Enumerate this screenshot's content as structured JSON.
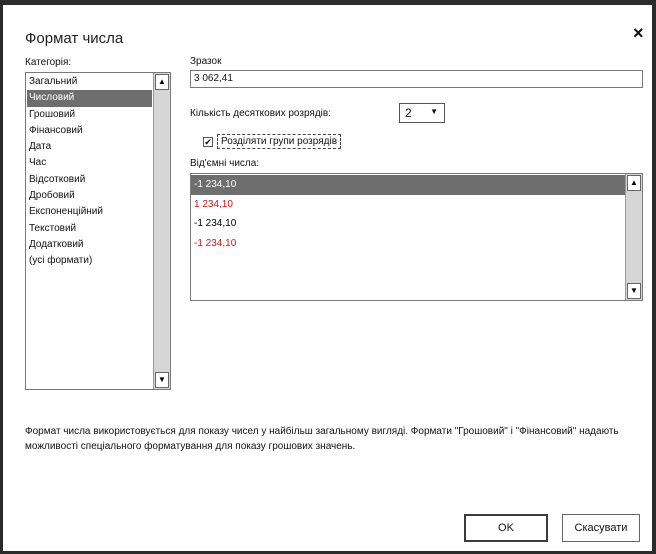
{
  "dialog": {
    "title": "Формат числа",
    "close_glyph": "×"
  },
  "category": {
    "label": "Категорія:",
    "items": [
      {
        "label": "Загальний"
      },
      {
        "label": "Числовий",
        "selected": true
      },
      {
        "label": "Грошовий"
      },
      {
        "label": "Фінансовий"
      },
      {
        "label": "Дата"
      },
      {
        "label": "Час"
      },
      {
        "label": "Відсотковий"
      },
      {
        "label": "Дробовий"
      },
      {
        "label": "Експоненційний"
      },
      {
        "label": "Текстовий"
      },
      {
        "label": "Додатковий"
      },
      {
        "label": "(усі формати)"
      }
    ]
  },
  "sample": {
    "label": "Зразок",
    "value": "3 062,41"
  },
  "decimal_places": {
    "label": "Кількість десяткових розрядів:",
    "value": "2"
  },
  "thousands_separator": {
    "label": "Розділяти групи розрядів",
    "checked": true
  },
  "negative_numbers": {
    "label": "Від'ємні числа:",
    "items": [
      {
        "text": "-1 234,10",
        "selected": true,
        "color": "#000000"
      },
      {
        "text": "1 234,10",
        "color": "#d01818"
      },
      {
        "text": "-1 234,10",
        "color": "#000000"
      },
      {
        "text": "-1 234,10",
        "color": "#d01818"
      }
    ]
  },
  "description": "Формат числа використовується для показу чисел у найбільш загальному вигляді. Формати \"Грошовий\" і \"Фінансовий\" надають можливості спеціального форматування для показу грошових значень.",
  "buttons": {
    "ok": "OK",
    "cancel": "Скасувати"
  },
  "scroll_glyphs": {
    "up": "▲",
    "down": "▼"
  }
}
